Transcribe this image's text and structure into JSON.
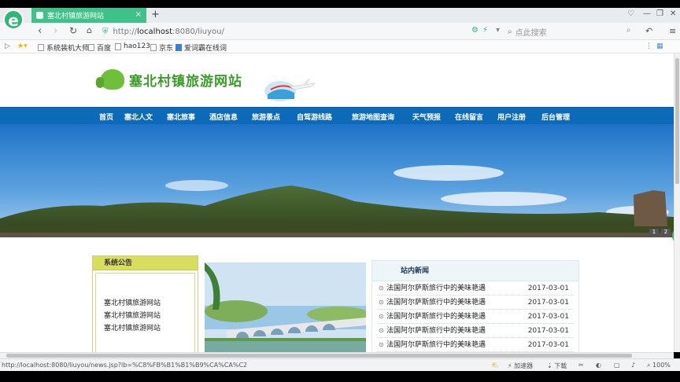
{
  "browser": {
    "tab_title": "塞北村镇旅游网站",
    "tab_close": "×",
    "new_tab": "+",
    "url_scheme": "http://",
    "url_host": "localhost",
    "url_rest": ":8080/liuyou/",
    "search_placeholder": "点此搜索",
    "logo_letter": "e"
  },
  "bookmarks": [
    {
      "label": "系统装机大师"
    },
    {
      "label": "百度"
    },
    {
      "label": "hao123"
    },
    {
      "label": "京东"
    },
    {
      "label": "爱词霸在线词"
    }
  ],
  "site": {
    "title": "塞北村镇旅游网站"
  },
  "nav": [
    {
      "label": "首页"
    },
    {
      "label": "塞北人文"
    },
    {
      "label": "塞北旅事"
    },
    {
      "label": "酒店信息"
    },
    {
      "label": "旅游景点"
    },
    {
      "label": "自驾游线路"
    },
    {
      "label": "旅游地图查询"
    },
    {
      "label": "天气预报"
    },
    {
      "label": "在线留言"
    },
    {
      "label": "用户注册"
    },
    {
      "label": "后台管理"
    }
  ],
  "banner": {
    "pages": [
      "1",
      "2"
    ]
  },
  "notice": {
    "title": "系统公告",
    "items": [
      "塞北村镇旅游网站",
      "塞北村镇旅游网站",
      "塞北村镇旅游网站"
    ]
  },
  "news": {
    "title": "站内新闻",
    "items": [
      {
        "text": "法国阿尔萨斯旅行中的美味艳遇",
        "date": "2017-03-01"
      },
      {
        "text": "法国阿尔萨斯旅行中的美味艳遇",
        "date": "2017-03-01"
      },
      {
        "text": "法国阿尔萨斯旅行中的美味艳遇",
        "date": "2017-03-01"
      },
      {
        "text": "法国阿尔萨斯旅行中的美味艳遇",
        "date": "2017-03-01"
      },
      {
        "text": "法国阿尔萨斯旅行中的美味艳遇",
        "date": "2017-03-01"
      }
    ]
  },
  "statusbar": {
    "url": "http://localhost:8080/liuyou/news.jsp?lb=%C8%FB%B1%B1%B9%CA%CA%C2",
    "accelerator": "加速器",
    "download": "下载",
    "zoom": "100%"
  },
  "colors": {
    "nav_bg": "#0d6ab8",
    "tab_green": "#3ec28a",
    "notice_head": "#d9dd5f"
  }
}
